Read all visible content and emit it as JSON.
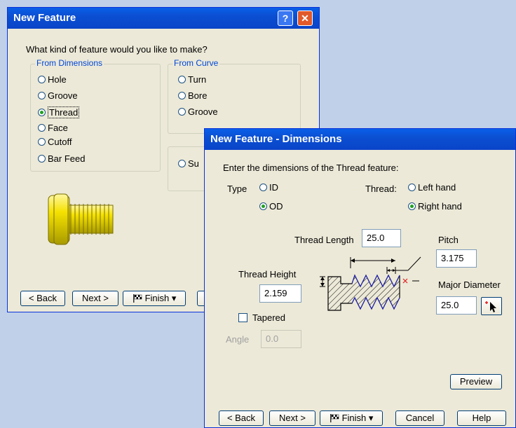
{
  "back_window": {
    "title": "New Feature",
    "question": "What kind of feature would you like to make?",
    "from_dimensions": {
      "label": "From Dimensions",
      "options": [
        "Hole",
        "Groove",
        "Thread",
        "Face",
        "Cutoff",
        "Bar Feed"
      ],
      "selected": "Thread"
    },
    "from_curve": {
      "label": "From Curve",
      "options": [
        "Turn",
        "Bore",
        "Groove"
      ]
    },
    "partial_option": "Su",
    "buttons": {
      "back": "< Back",
      "next": "Next >",
      "finish": "Finish"
    }
  },
  "front_window": {
    "title": "New Feature - Dimensions",
    "prompt": "Enter the dimensions of the Thread feature:",
    "type_label": "Type",
    "type_options": [
      "ID",
      "OD"
    ],
    "type_selected": "OD",
    "thread_label": "Thread:",
    "thread_options": [
      "Left hand",
      "Right hand"
    ],
    "thread_selected": "Right hand",
    "thread_length_label": "Thread Length",
    "thread_length_value": "25.0",
    "pitch_label": "Pitch",
    "pitch_value": "3.175",
    "thread_height_label": "Thread Height",
    "thread_height_value": "2.159",
    "major_diameter_label": "Major Diameter",
    "major_diameter_value": "25.0",
    "tapered_label": "Tapered",
    "angle_label": "Angle",
    "angle_value": "0.0",
    "preview_label": "Preview",
    "buttons": {
      "back": "< Back",
      "next": "Next >",
      "finish": "Finish",
      "cancel": "Cancel",
      "help": "Help"
    }
  },
  "colors": {
    "title_blue": "#0a4fd2",
    "group_label": "#0046d5",
    "radio_dot": "#21a121",
    "part_yellow": "#f2e000"
  }
}
